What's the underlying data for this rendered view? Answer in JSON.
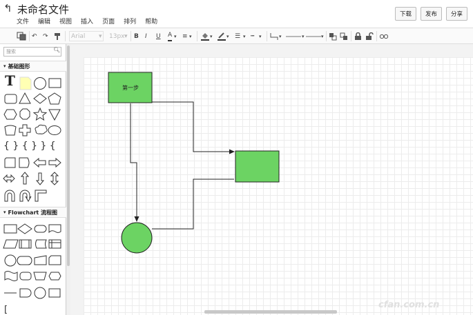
{
  "header": {
    "title": "未命名文件",
    "menu": [
      "文件",
      "编辑",
      "视图",
      "插入",
      "页面",
      "排列",
      "帮助"
    ],
    "buttons": {
      "download": "下载",
      "publish": "发布",
      "share": "分享"
    }
  },
  "toolbar": {
    "font": "Arial",
    "font_size": "13px",
    "bold": "B",
    "italic": "I",
    "underline": "U",
    "font_color": "A"
  },
  "sidebar": {
    "search_placeholder": "搜索",
    "sections": {
      "basic": "基础图形",
      "flowchart": "Flowchart 流程图"
    }
  },
  "canvas": {
    "node1_label": "第一步",
    "fill_color": "#6cd363",
    "stroke_color": "#222222"
  },
  "watermark": "cfan.com.cn"
}
